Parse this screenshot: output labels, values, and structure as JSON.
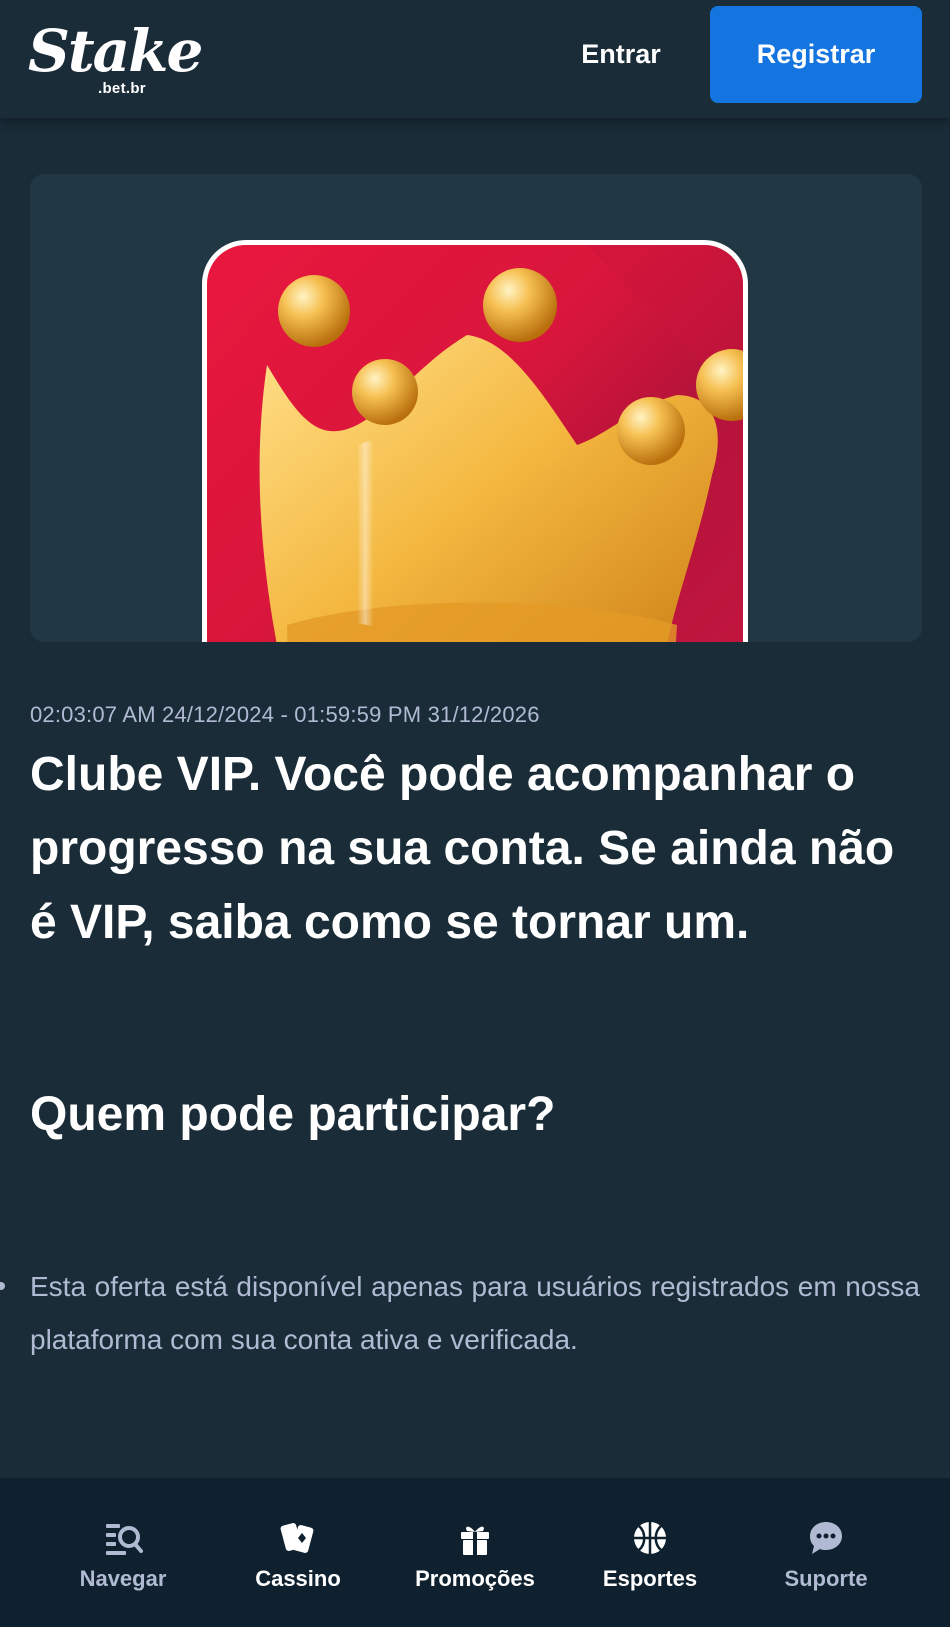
{
  "header": {
    "logo_text": "Stake",
    "logo_subtext": ".bet.br",
    "login_label": "Entrar",
    "register_label": "Registrar"
  },
  "promo": {
    "date_range": "02:03:07 AM 24/12/2024 - 01:59:59 PM 31/12/2026",
    "title": "Clube VIP. Você pode acompanhar o progresso na sua conta. Se ainda não é VIP, saiba como se tornar um.",
    "section_heading": "Quem pode participar?",
    "bullets": [
      "Esta oferta está disponível apenas para usuários registrados em nossa plataforma com sua conta ativa e verificada."
    ]
  },
  "bottom_nav": {
    "items": [
      {
        "label": "Navegar",
        "icon": "browse-icon"
      },
      {
        "label": "Cassino",
        "icon": "cards-icon"
      },
      {
        "label": "Promoções",
        "icon": "gift-icon"
      },
      {
        "label": "Esportes",
        "icon": "basketball-icon"
      },
      {
        "label": "Suporte",
        "icon": "chat-icon"
      }
    ]
  },
  "colors": {
    "background": "#1a2c38",
    "card": "#213743",
    "accent_blue": "#1475e1",
    "muted_text": "#b1bad3",
    "nav_background": "#0f212e",
    "crown_card_red": "#e8173e",
    "crown_gold": "#f2b33d"
  }
}
